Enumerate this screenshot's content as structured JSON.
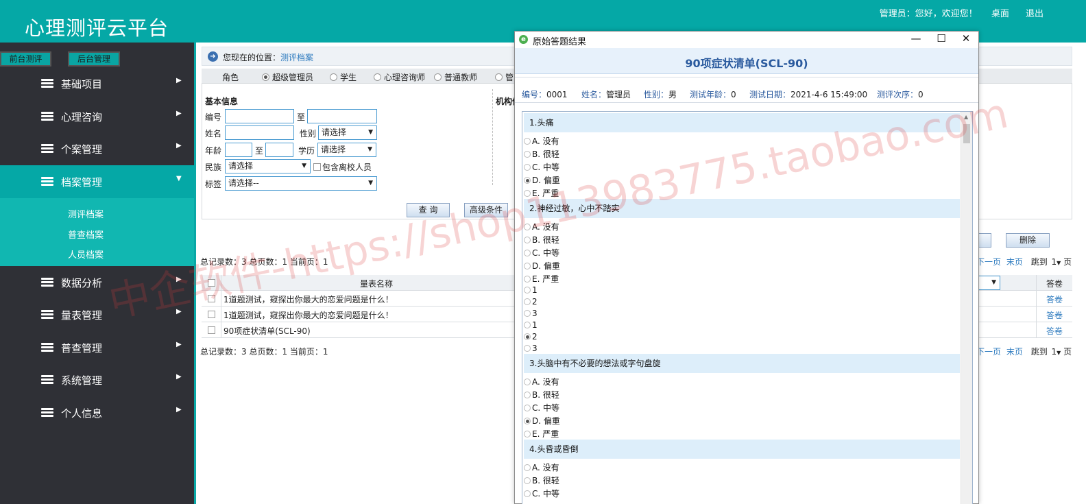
{
  "header": {
    "logo": "心理测评云平台",
    "greeting": "管理员：您好，欢迎您！",
    "desktop_link": "桌面",
    "logout_link": "退出"
  },
  "sidebar": {
    "front_btn": "前台测评",
    "back_btn": "后台管理",
    "items": [
      {
        "label": "基础项目",
        "icon": "stack-icon"
      },
      {
        "label": "心理咨询",
        "icon": "stack-icon"
      },
      {
        "label": "个案管理",
        "icon": "stack-icon"
      },
      {
        "label": "档案管理",
        "icon": "stack-icon",
        "active": true
      },
      {
        "label": "数据分析",
        "icon": "stack-icon"
      },
      {
        "label": "量表管理",
        "icon": "stack-icon"
      },
      {
        "label": "普查管理",
        "icon": "stack-icon"
      },
      {
        "label": "系统管理",
        "icon": "stack-icon"
      },
      {
        "label": "个人信息",
        "icon": "stack-icon"
      }
    ],
    "submenu": [
      "测评档案",
      "普查档案",
      "人员档案"
    ]
  },
  "main": {
    "location_prefix": "您现在的位置：",
    "location_link": "测评档案",
    "roles_label": "角色",
    "roles": [
      "超级管理员",
      "学生",
      "心理咨询师",
      "普通教师",
      "管"
    ],
    "section_basic": "基本信息",
    "section_org": "机构信",
    "fields": {
      "id": "编号",
      "to": "至",
      "name": "姓名",
      "gender": "性别",
      "gender_value": "请选择",
      "age": "年龄",
      "age_to": "至",
      "education": "学历",
      "education_value": "请选择",
      "ethnicity": "民族",
      "ethnicity_value": "请选择",
      "include_left": "包含离校人员",
      "tag": "标签",
      "tag_value": "请选择--"
    },
    "query_btn": "查 询",
    "advanced_btn": "高级条件",
    "delete_btn": "删除",
    "records_top": "总记录数：3 总页数：1 当前页：1",
    "records_bottom": "总记录数：3 总页数：1 当前页：1",
    "pager": {
      "next": "下一页",
      "last": "末页",
      "jump": "跳到",
      "page_num": "1",
      "page_unit": "页"
    },
    "table": {
      "col_name": "量表名称",
      "col_answer": "答卷",
      "rows": [
        {
          "name": "1道题测试，窥探出你最大的恋爱问题是什么！",
          "action": "答卷"
        },
        {
          "name": "1道题测试，窥探出你最大的恋爱问题是什么！",
          "action": "答卷"
        },
        {
          "name": "90项症状清单(SCL-90)",
          "action": "答卷"
        }
      ]
    }
  },
  "dialog": {
    "window_title": "原始答题结果",
    "heading": "90项症状清单(SCL-90)",
    "info": [
      {
        "k": "编号：",
        "v": "0001"
      },
      {
        "k": "姓名：",
        "v": "管理员"
      },
      {
        "k": "性别：",
        "v": "男"
      },
      {
        "k": "测试年龄：",
        "v": "0"
      },
      {
        "k": "测试日期：",
        "v": "2021-4-6 15:49:00"
      },
      {
        "k": "测评次序：",
        "v": "0"
      }
    ],
    "q1": {
      "title": "1.头痛",
      "options": [
        "A. 没有",
        "B. 很轻",
        "C. 中等",
        "D. 偏重",
        "E. 严重"
      ],
      "selected": 3
    },
    "q2": {
      "title": "2.神经过敏，心中不踏实",
      "options": [
        "A. 没有",
        "B. 很轻",
        "C. 中等",
        "D. 偏重",
        "E. 严重"
      ],
      "extra": [
        "1",
        "2",
        "3",
        "1",
        "2",
        "3"
      ],
      "extra_selected": 4
    },
    "q3": {
      "title": "3.头脑中有不必要的想法或字句盘旋",
      "options": [
        "A. 没有",
        "B. 很轻",
        "C. 中等",
        "D. 偏重",
        "E. 严重"
      ],
      "selected": 3
    },
    "q4": {
      "title": "4.头昏或昏倒",
      "options": [
        "A. 没有",
        "B. 很轻",
        "C. 中等"
      ]
    }
  },
  "watermark": "中企软件-https://shop113983775.taobao.com"
}
